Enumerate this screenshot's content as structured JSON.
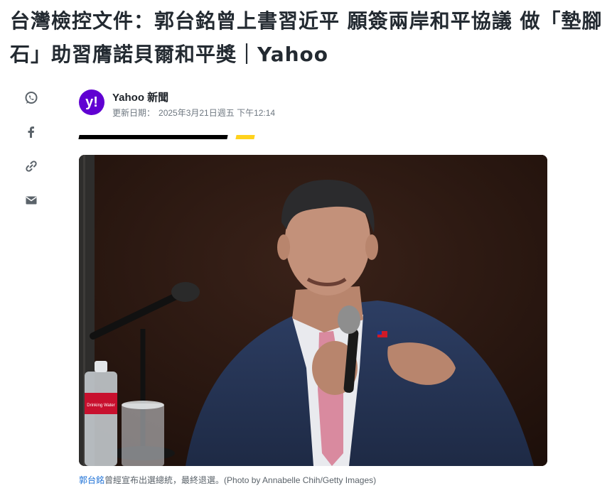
{
  "article": {
    "title": "台灣檢控文件：郭台銘曾上書習近平 願簽兩岸和平協議 做「墊腳石」助習膺諾貝爾和平獎｜Yahoo"
  },
  "share": {
    "items": [
      {
        "icon": "whatsapp-icon"
      },
      {
        "icon": "facebook-icon"
      },
      {
        "icon": "link-icon"
      },
      {
        "icon": "email-icon"
      }
    ]
  },
  "byline": {
    "avatar_letter": "y!",
    "source": "Yahoo 新聞",
    "date_label": "更新日期：",
    "date_value": "2025年3月21日週五 下午12:14"
  },
  "colors": {
    "brand_purple": "#6001d2",
    "accent_yellow": "#ffd21d",
    "link_blue": "#1a6fd6"
  },
  "photo": {
    "bottle_label": "Drinking Water"
  },
  "caption": {
    "link_text": "郭台銘",
    "rest": "曾經宣布出選總統，最終退選。(Photo by Annabelle Chih/Getty Images)"
  }
}
